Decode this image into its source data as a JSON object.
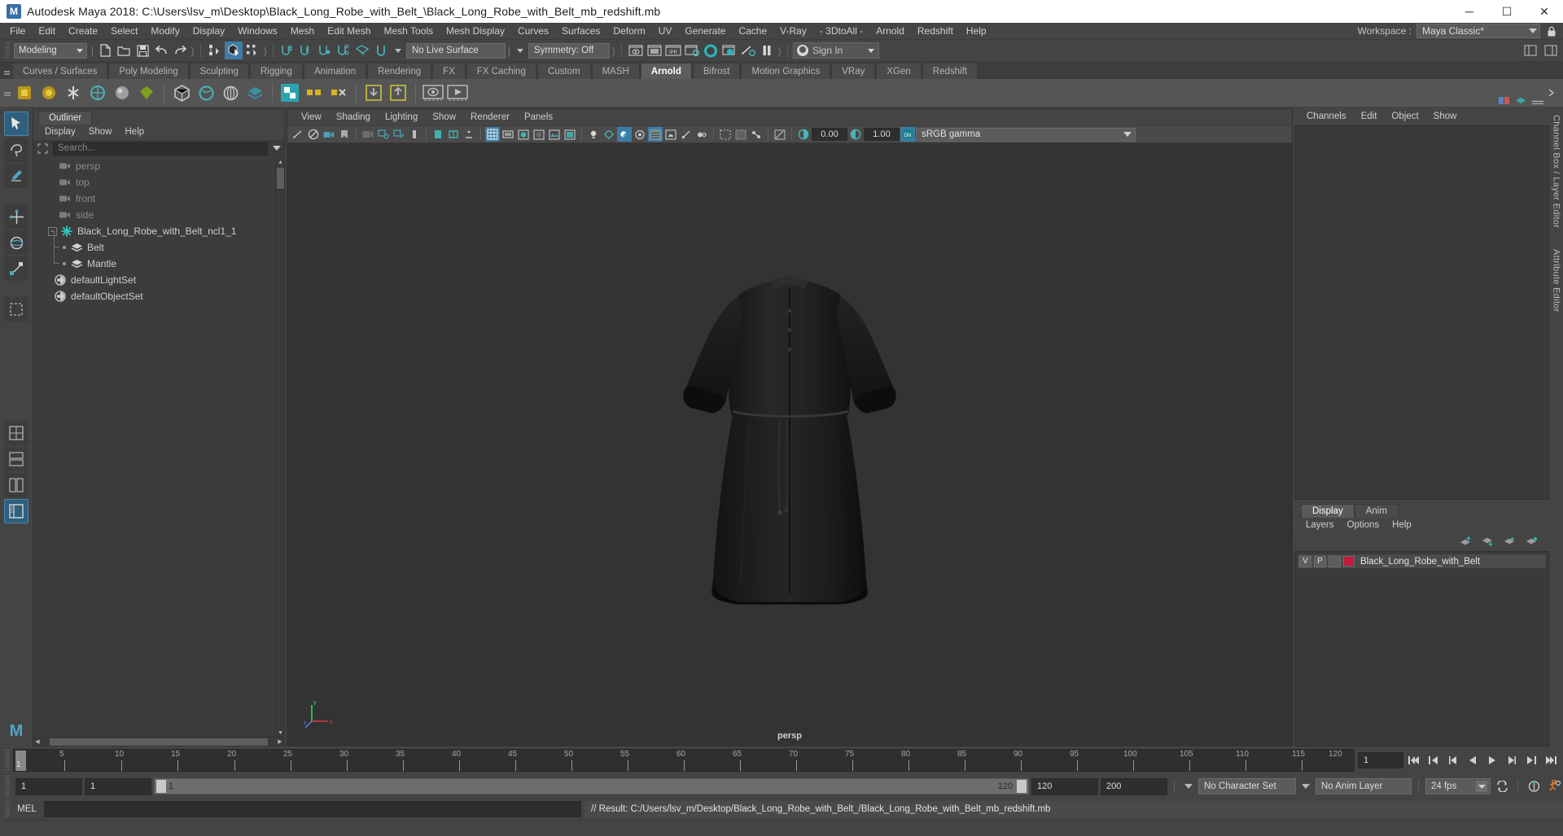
{
  "window": {
    "title": "Autodesk Maya 2018: C:\\Users\\lsv_m\\Desktop\\Black_Long_Robe_with_Belt_\\Black_Long_Robe_with_Belt_mb_redshift.mb",
    "logo": "maya-logo",
    "minimize": "─",
    "maximize": "☐",
    "close": "✕"
  },
  "menubar": {
    "items": [
      "File",
      "Edit",
      "Create",
      "Select",
      "Modify",
      "Display",
      "Windows",
      "Mesh",
      "Edit Mesh",
      "Mesh Tools",
      "Mesh Display",
      "Curves",
      "Surfaces",
      "Deform",
      "UV",
      "Generate",
      "Cache",
      "V-Ray",
      "- 3DtoAll -",
      "Arnold",
      "Redshift",
      "Help"
    ],
    "workspace_label": "Workspace :",
    "workspace_value": "Maya Classic*",
    "lock_icon": "lock-icon"
  },
  "statusline": {
    "mode": "Modeling",
    "live_surface": "No Live Surface",
    "symmetry": "Symmetry: Off",
    "render_value_1": "0.00",
    "render_value_2": "1.00",
    "signin": "Sign In"
  },
  "shelf": {
    "tabs": [
      {
        "label": "Curves / Surfaces",
        "active": false
      },
      {
        "label": "Poly Modeling",
        "active": false
      },
      {
        "label": "Sculpting",
        "active": false
      },
      {
        "label": "Rigging",
        "active": false
      },
      {
        "label": "Animation",
        "active": false
      },
      {
        "label": "Rendering",
        "active": false
      },
      {
        "label": "FX",
        "active": false
      },
      {
        "label": "FX Caching",
        "active": false
      },
      {
        "label": "Custom",
        "active": false
      },
      {
        "label": "MASH",
        "active": false
      },
      {
        "label": "Arnold",
        "active": true
      },
      {
        "label": "Bifrost",
        "active": false
      },
      {
        "label": "Motion Graphics",
        "active": false
      },
      {
        "label": "VRay",
        "active": false
      },
      {
        "label": "XGen",
        "active": false
      },
      {
        "label": "Redshift",
        "active": false
      }
    ]
  },
  "outliner": {
    "tab": "Outliner",
    "menu": [
      "Display",
      "Show",
      "Help"
    ],
    "search_placeholder": "Search...",
    "items": [
      {
        "label": "persp",
        "icon": "camera-icon",
        "dim": true,
        "level": 1
      },
      {
        "label": "top",
        "icon": "camera-icon",
        "dim": true,
        "level": 1
      },
      {
        "label": "front",
        "icon": "camera-icon",
        "dim": true,
        "level": 1
      },
      {
        "label": "side",
        "icon": "camera-icon",
        "dim": true,
        "level": 1
      },
      {
        "label": "Black_Long_Robe_with_Belt_ncl1_1",
        "icon": "ncloth-icon",
        "dim": false,
        "level": 0,
        "expanded": true
      },
      {
        "label": "Belt",
        "icon": "mesh-icon",
        "dim": false,
        "level": 2
      },
      {
        "label": "Mantle",
        "icon": "mesh-icon",
        "dim": false,
        "level": 2
      },
      {
        "label": "defaultLightSet",
        "icon": "set-icon",
        "dim": false,
        "level": 1
      },
      {
        "label": "defaultObjectSet",
        "icon": "set-icon",
        "dim": false,
        "level": 1
      }
    ]
  },
  "viewport": {
    "menu": [
      "View",
      "Shading",
      "Lighting",
      "Show",
      "Renderer",
      "Panels"
    ],
    "exposure": "0.00",
    "gamma_value": "1.00",
    "color_profile": "sRGB gamma",
    "camera_label": "persp",
    "axis": {
      "x": "x",
      "y": "y",
      "z": "z"
    }
  },
  "channelbox": {
    "menu": [
      "Channels",
      "Edit",
      "Object",
      "Show"
    ],
    "vertical_label": "Channel Box / Layer Editor",
    "attr_label": "Attribute Editor"
  },
  "layereditor": {
    "tabs": [
      {
        "label": "Display",
        "active": true
      },
      {
        "label": "Anim",
        "active": false
      }
    ],
    "menu": [
      "Layers",
      "Options",
      "Help"
    ],
    "rows": [
      {
        "v": "V",
        "p": "P",
        "blank": "",
        "color": "#c21a3a",
        "name": "Black_Long_Robe_with_Belt"
      }
    ]
  },
  "timeslider": {
    "current_frame": "1",
    "ticks": [
      "5",
      "10",
      "15",
      "20",
      "25",
      "30",
      "35",
      "40",
      "45",
      "50",
      "55",
      "60",
      "65",
      "70",
      "75",
      "80",
      "85",
      "90",
      "95",
      "100",
      "105",
      "110",
      "115",
      "120"
    ],
    "end_field": "1"
  },
  "rangeslider": {
    "start": "1",
    "anim_start": "1",
    "bar_start": "1",
    "bar_end": "120",
    "anim_end": "120",
    "end": "200",
    "character_set": "No Character Set",
    "anim_layer": "No Anim Layer",
    "fps": "24 fps"
  },
  "commandline": {
    "label": "MEL",
    "input_value": "",
    "result": "// Result: C:/Users/lsv_m/Desktop/Black_Long_Robe_with_Belt_/Black_Long_Robe_with_Belt_mb_redshift.mb"
  },
  "colors": {
    "accent": "#3e7ca6",
    "panel_bg": "#444444",
    "viewport_bg": "#333333",
    "layer_color": "#c21a3a",
    "title_bg": "#ffffff"
  }
}
